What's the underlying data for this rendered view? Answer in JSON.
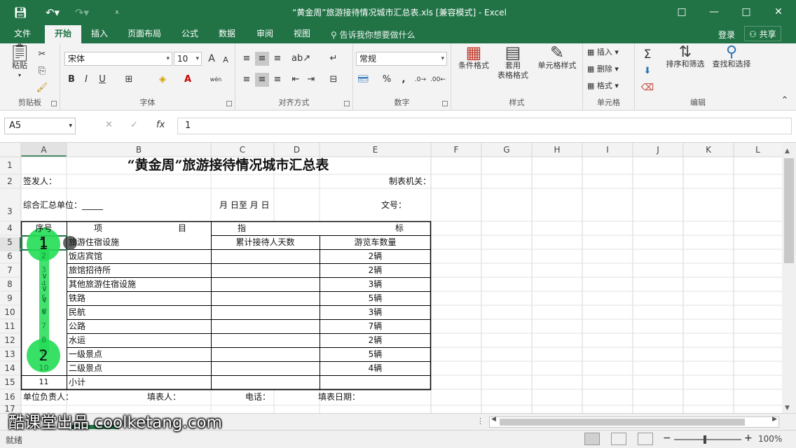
{
  "window": {
    "title": "“黄金周”旅游接待情况城市汇总表.xls  [兼容模式] - Excel",
    "controls": [
      "□",
      "—",
      "□",
      "✕"
    ]
  },
  "menu": {
    "tabs": [
      "文件",
      "开始",
      "插入",
      "页面布局",
      "公式",
      "数据",
      "审阅",
      "视图"
    ],
    "active_tab": "开始",
    "tell_me": "告诉我你想要做什么",
    "login": "登录",
    "share": "共享"
  },
  "ribbon": {
    "clipboard": {
      "label": "剪贴板",
      "paste": "粘贴"
    },
    "font": {
      "label": "字体",
      "name": "宋体",
      "size": "10",
      "bold": "B",
      "italic": "I",
      "underline": "U",
      "inc": "A",
      "dec": "A",
      "wen": "wén"
    },
    "alignment": {
      "label": "对齐方式"
    },
    "number": {
      "label": "数字",
      "format": "常规",
      "percent": "%",
      "comma": ","
    },
    "styles": {
      "label": "样式",
      "conditional": "条件格式",
      "table": "套用",
      "table2": "表格格式",
      "cell": "单元格样式"
    },
    "cells": {
      "label": "单元格",
      "insert": "插入",
      "delete": "删除",
      "format": "格式"
    },
    "editing": {
      "label": "编辑",
      "sort": "排序和筛选",
      "find": "查找和选择"
    }
  },
  "formula_bar": {
    "name_box": "A5",
    "cancel": "✕",
    "enter": "✓",
    "fx": "fx",
    "content": "1"
  },
  "sheet": {
    "columns": [
      "A",
      "B",
      "C",
      "D",
      "E",
      "F",
      "G",
      "H",
      "I",
      "J",
      "K",
      "L"
    ],
    "rows": [
      "1",
      "2",
      "3",
      "4",
      "5",
      "6",
      "7",
      "8",
      "9",
      "10",
      "11",
      "12",
      "13",
      "14",
      "15",
      "16",
      "17"
    ],
    "title": "“黄金周”旅游接待情况城市汇总表",
    "issuer": "签发人：",
    "maker": "制表机关：",
    "unit": "综合汇总单位：_____",
    "date_range": "月  日至  月  日",
    "doc_no": "文号：",
    "hdr_seq": "序号",
    "hdr_item": "项",
    "hdr_item2": "目",
    "hdr_ind": "指",
    "hdr_ind2": "标",
    "hdr_days": "累计接待人天数",
    "hdr_buses": "游览车数量",
    "items": [
      {
        "seq": "1",
        "name": "旅游住宿设施",
        "buses": ""
      },
      {
        "seq": "2",
        "name": "饭店宾馆",
        "buses": "2辆"
      },
      {
        "seq": "3",
        "name": "旅馆招待所",
        "buses": "2辆"
      },
      {
        "seq": "4",
        "name": "其他旅游住宿设施",
        "buses": "3辆"
      },
      {
        "seq": "5",
        "name": "铁路",
        "buses": "5辆"
      },
      {
        "seq": "6",
        "name": "民航",
        "buses": "3辆"
      },
      {
        "seq": "7",
        "name": "公路",
        "buses": "7辆"
      },
      {
        "seq": "8",
        "name": "水运",
        "buses": "2辆"
      },
      {
        "seq": "9",
        "name": "一级景点",
        "buses": "5辆"
      },
      {
        "seq": "10",
        "name": "二级景点",
        "buses": "4辆"
      },
      {
        "seq": "11",
        "name": "小计",
        "buses": ""
      }
    ],
    "footer_unit": "单位负责人：",
    "footer_filler": "填表人：",
    "footer_phone": "电话：",
    "footer_date": "填表日期："
  },
  "overlay": {
    "marker1": "1",
    "marker2": "2"
  },
  "status": {
    "ready": "就绪",
    "zoom": "100%"
  },
  "watermark": "酷课堂出品 coolketang.com",
  "colors": {
    "excel_green": "#217346",
    "highlight_green": "#22dd55"
  }
}
